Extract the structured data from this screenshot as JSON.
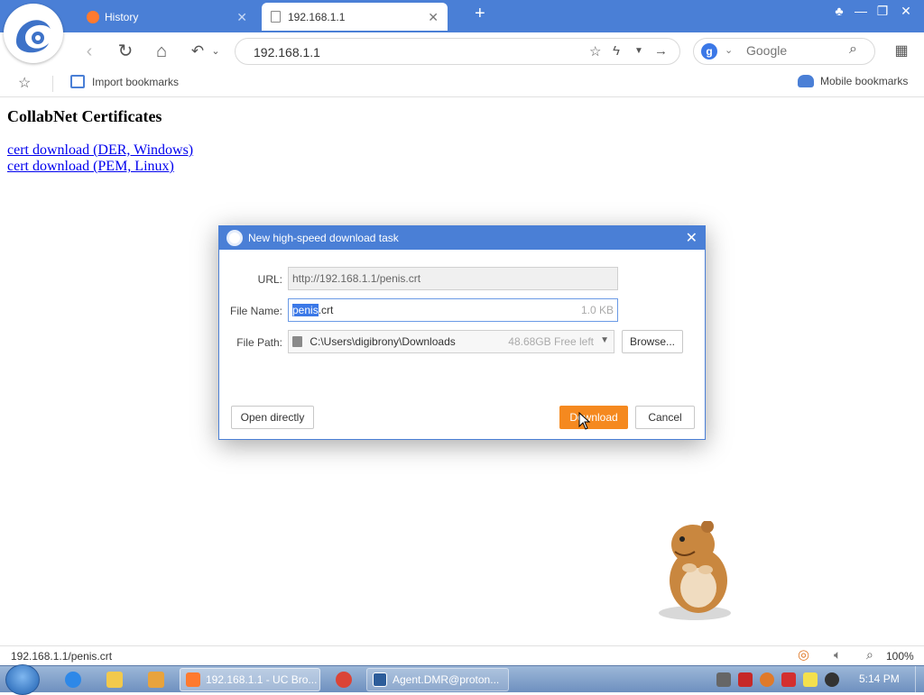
{
  "browser": {
    "tabs": [
      {
        "label": "History",
        "active": false
      },
      {
        "label": "192.168.1.1",
        "active": true
      }
    ],
    "address": "192.168.1.1",
    "search_placeholder": "Google",
    "bookmarks": {
      "import_label": "Import bookmarks",
      "mobile_label": "Mobile bookmarks"
    }
  },
  "page": {
    "title": "CollabNet Certificates",
    "links": [
      "cert download (DER, Windows)",
      "cert download (PEM, Linux)"
    ]
  },
  "dialog": {
    "title": "New high-speed download task",
    "url_label": "URL:",
    "url_value": "http://192.168.1.1/penis.crt",
    "filename_label": "File Name:",
    "filename_selected": "penis",
    "filename_rest": ".crt",
    "filesize": "1.0 KB",
    "filepath_label": "File Path:",
    "filepath_value": "C:\\Users\\digibrony\\Downloads",
    "free_space": "48.68GB Free left",
    "browse_label": "Browse...",
    "open_directly_label": "Open directly",
    "download_label": "Download",
    "cancel_label": "Cancel"
  },
  "statusbar": {
    "url": "192.168.1.1/penis.crt",
    "zoom": "100%"
  },
  "taskbar": {
    "items": [
      {
        "label": "192.168.1.1 - UC Bro..."
      },
      {
        "label": "Agent.DMR@proton..."
      }
    ],
    "clock": "5:14 PM"
  },
  "colors": {
    "accent": "#4a7fd6",
    "download_button": "#f5891f",
    "link": "#0000ee"
  }
}
